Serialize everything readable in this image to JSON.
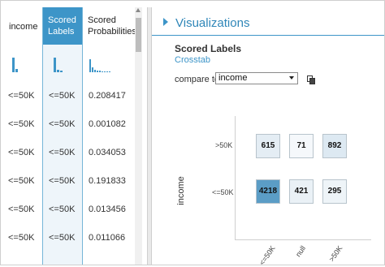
{
  "table": {
    "headers": {
      "income": "income",
      "scored_labels_line1": "Scored",
      "scored_labels_line2": "Labels",
      "scored_prob_line1": "Scored",
      "scored_prob_line2": "Probabilities"
    },
    "rows": [
      {
        "income": "<=50K",
        "scored_labels": "<=50K",
        "scored_probabilities": "0.208417"
      },
      {
        "income": "<=50K",
        "scored_labels": "<=50K",
        "scored_probabilities": "0.001082"
      },
      {
        "income": "<=50K",
        "scored_labels": "<=50K",
        "scored_probabilities": "0.034053"
      },
      {
        "income": "<=50K",
        "scored_labels": "<=50K",
        "scored_probabilities": "0.191833"
      },
      {
        "income": "<=50K",
        "scored_labels": "<=50K",
        "scored_probabilities": "0.013456"
      },
      {
        "income": "<=50K",
        "scored_labels": "<=50K",
        "scored_probabilities": "0.011066"
      }
    ]
  },
  "panel": {
    "title": "Visualizations",
    "section_title": "Scored Labels",
    "subtitle": "Crosstab",
    "compare_label": "compare to",
    "compare_value": "income"
  },
  "crosstab": {
    "y_title": "income",
    "y_ticks": [
      ">50K",
      "<=50K"
    ],
    "x_ticks": [
      "<=50K",
      "null",
      ">50K"
    ],
    "cells": [
      [
        {
          "value": "615",
          "color": "#e4edf4"
        },
        {
          "value": "71",
          "color": "#f5f8fb"
        },
        {
          "value": "892",
          "color": "#dde9f2"
        }
      ],
      [
        {
          "value": "4218",
          "color": "#5b9dc6"
        },
        {
          "value": "421",
          "color": "#eaf1f6"
        },
        {
          "value": "295",
          "color": "#eef4f8"
        }
      ]
    ]
  },
  "colors": {
    "accent": "#3d95c8"
  }
}
